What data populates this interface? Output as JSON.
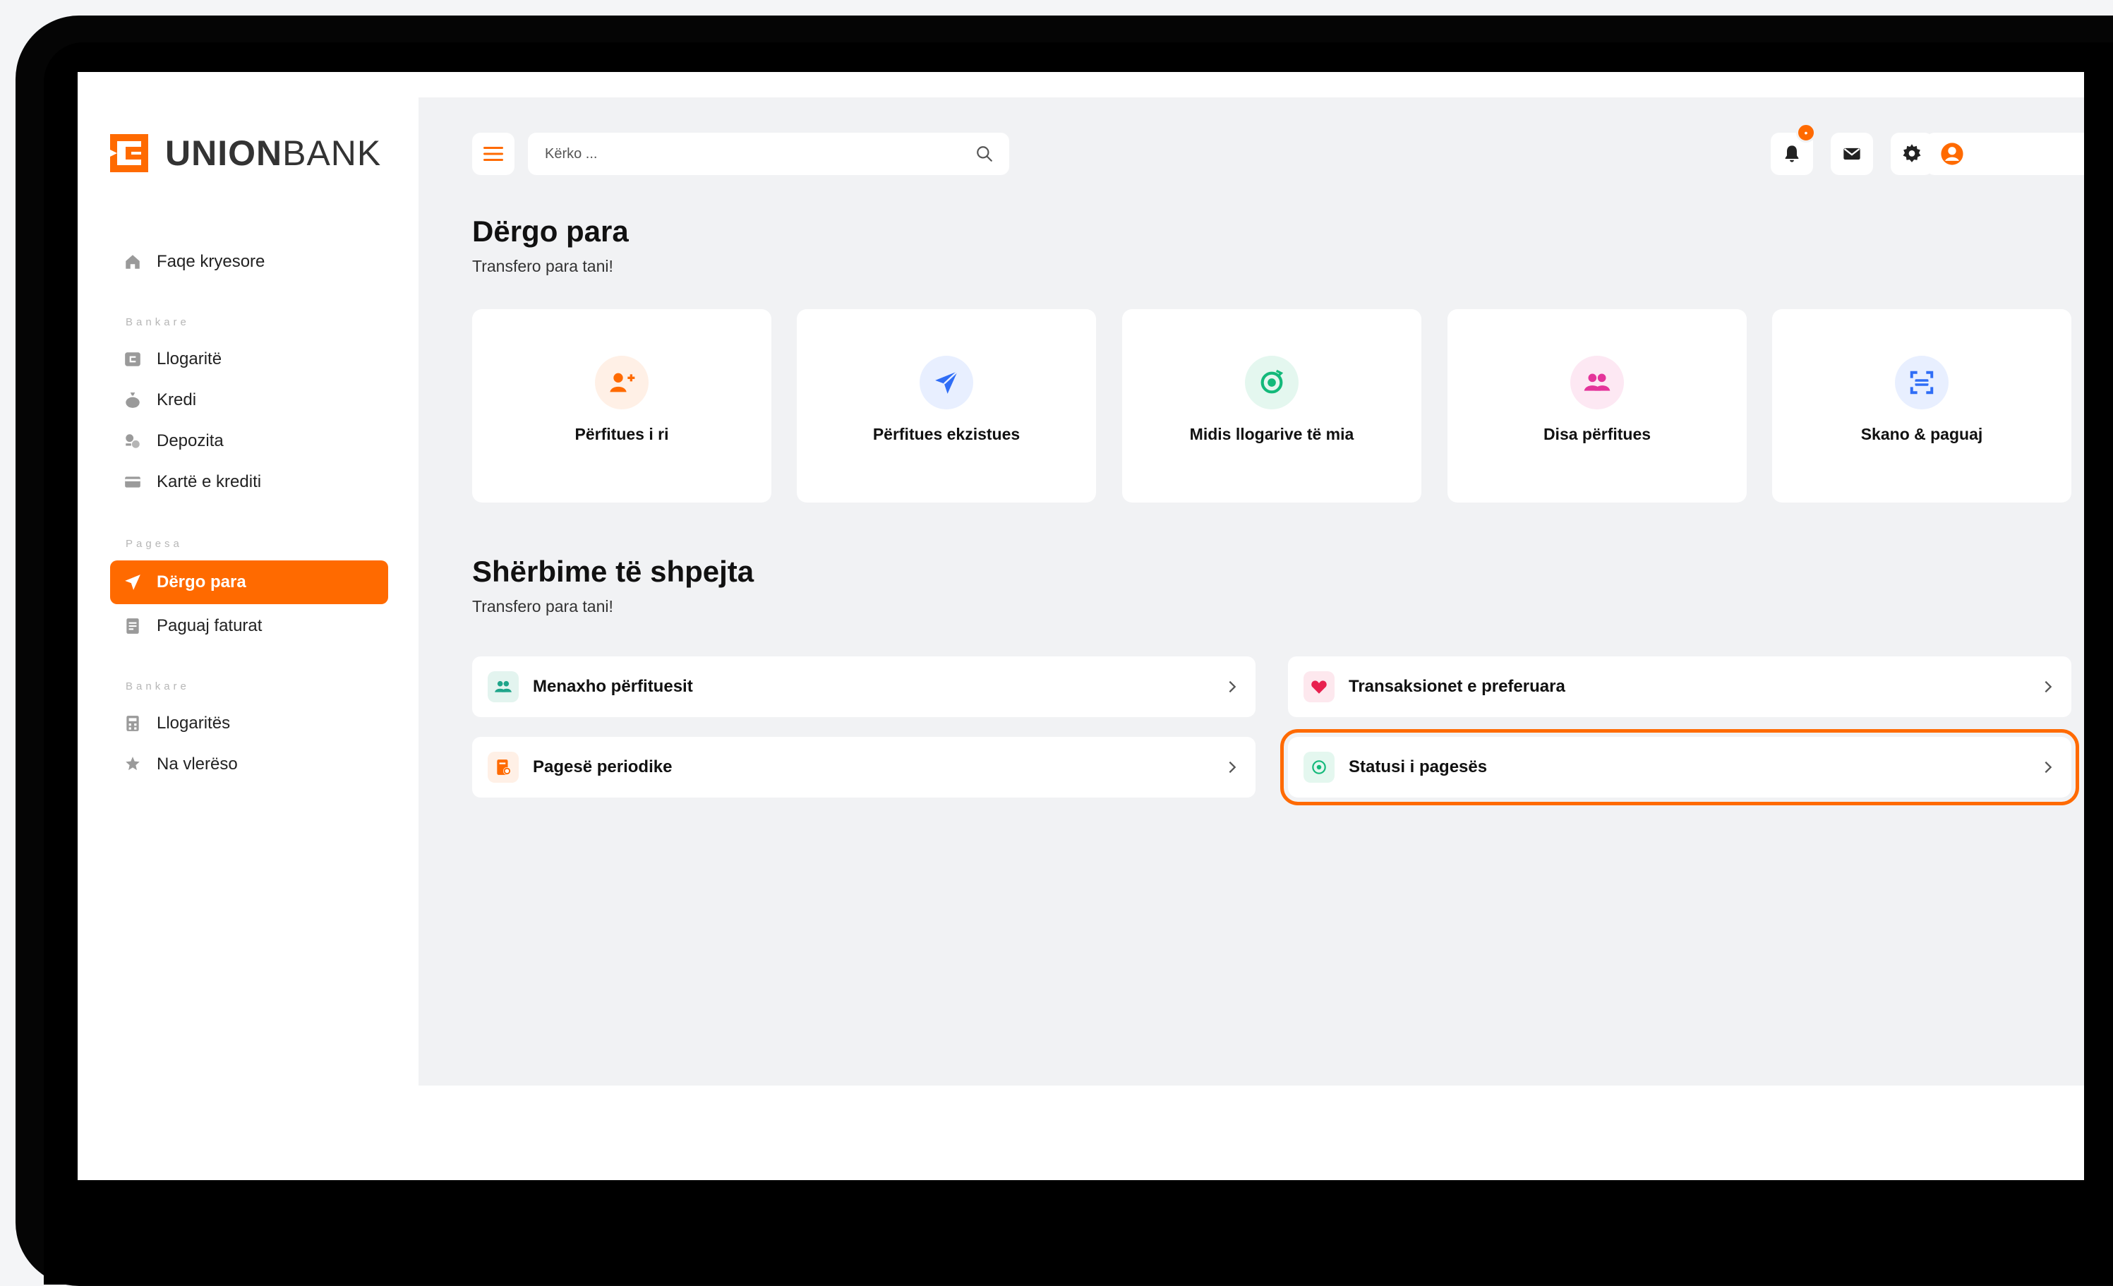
{
  "brand": {
    "name_bold": "UNION",
    "name_regular": "BANK",
    "accent_color": "#ff6a00"
  },
  "sidebar": {
    "home": "Faqe kryesore",
    "section_banking": "Bankare",
    "banking_items": [
      "Llogaritë",
      "Kredi",
      "Depozita",
      "Kartë e krediti"
    ],
    "section_payments": "Pagesa",
    "payment_items": [
      "Dërgo para",
      "Paguaj faturat"
    ],
    "section_banking_2": "Bankare",
    "tools_items": [
      "Llogaritës",
      "Na vlerëso"
    ]
  },
  "topbar": {
    "search_placeholder": "Kërko ...",
    "notification_icon": "bell-icon",
    "mail_icon": "mail-icon",
    "settings_icon": "gear-icon",
    "profile_icon": "user-circle-icon"
  },
  "send_money": {
    "title": "Dërgo para",
    "subtitle": "Transfero para tani!",
    "options": [
      {
        "label": "Përfitues i ri",
        "icon": "user-plus-icon",
        "color": "#ff6a00",
        "bg": "#fff0e6"
      },
      {
        "label": "Përfitues ekzistues",
        "icon": "paper-plane-icon",
        "color": "#2f6df6",
        "bg": "#e8efff"
      },
      {
        "label": "Midis llogarive të mia",
        "icon": "transfer-cycle-icon",
        "color": "#13b97a",
        "bg": "#e4f7ef"
      },
      {
        "label": "Disa përfitues",
        "icon": "users-icon",
        "color": "#e4349a",
        "bg": "#fde8f3"
      },
      {
        "label": "Skano & paguaj",
        "icon": "scan-icon",
        "color": "#2f6df6",
        "bg": "#e8efff"
      }
    ]
  },
  "quick_services": {
    "title": "Shërbime të shpejta",
    "subtitle": "Transfero para tani!",
    "items": [
      {
        "label": "Menaxho përfituesit",
        "icon": "users-icon",
        "color": "#1fa58a",
        "bg": "#e3f4ef"
      },
      {
        "label": "Transaksionet e preferuara",
        "icon": "heart-icon",
        "color": "#e8214f",
        "bg": "#fde8ee"
      },
      {
        "label": "Pagesë periodike",
        "icon": "recurring-bill-icon",
        "color": "#ff6a00",
        "bg": "#fff0e6"
      },
      {
        "label": "Statusi i pagesës",
        "icon": "payment-status-icon",
        "color": "#13b97a",
        "bg": "#e4f7ef"
      }
    ]
  }
}
